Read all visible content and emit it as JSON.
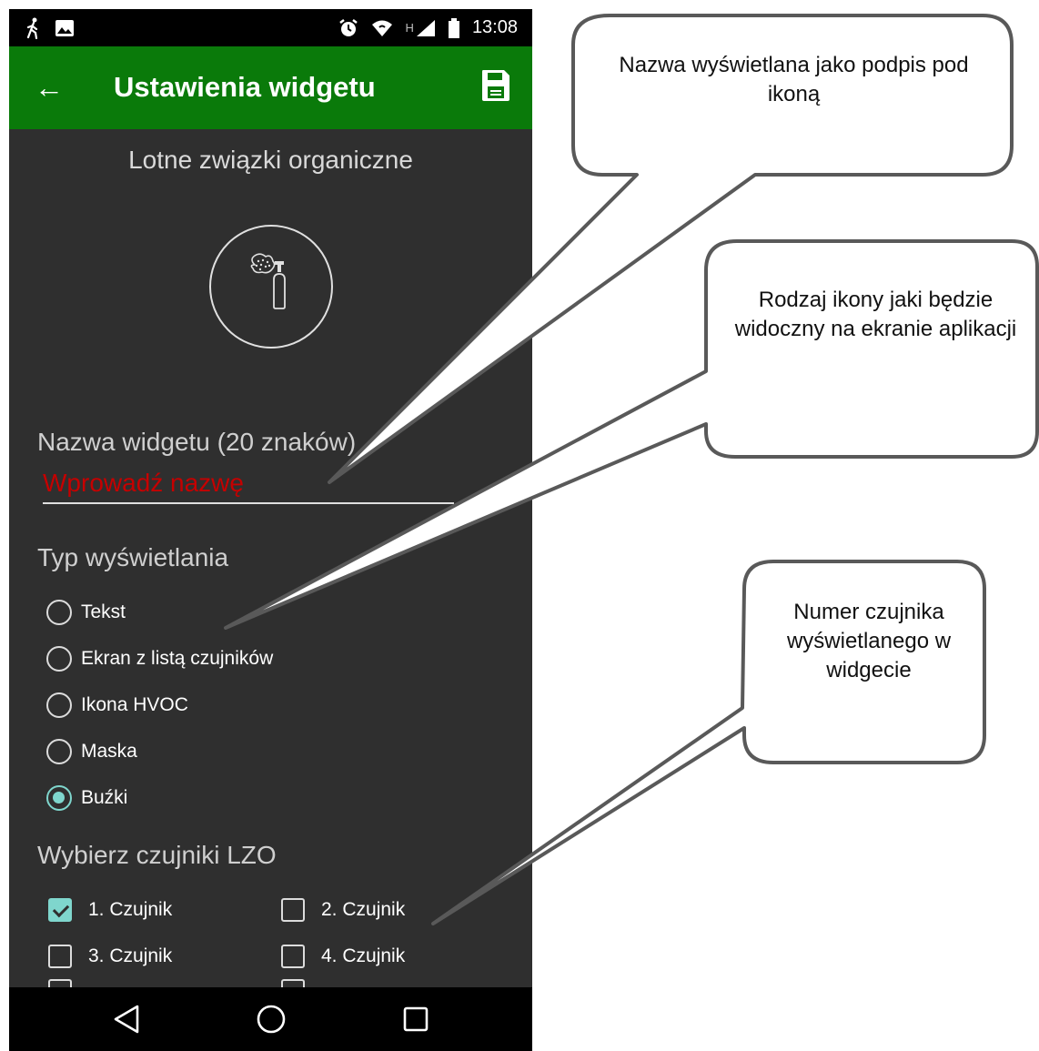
{
  "statusbar": {
    "time": "13:08",
    "network": "H"
  },
  "appbar": {
    "back_glyph": "←",
    "title": "Ustawienia widgetu",
    "save_icon": "save-icon"
  },
  "sensor_type": "Lotne związki organiczne",
  "widget_icon": "hvoc-spray-icon",
  "name_section": {
    "label": "Nazwa widgetu (20 znaków)",
    "placeholder": "Wprowadź nazwę"
  },
  "display_section": {
    "label": "Typ wyświetlania",
    "options": [
      {
        "label": "Tekst",
        "checked": false
      },
      {
        "label": "Ekran z listą czujników",
        "checked": false
      },
      {
        "label": "Ikona HVOC",
        "checked": false
      },
      {
        "label": "Maska",
        "checked": false
      },
      {
        "label": "Buźki",
        "checked": true
      }
    ]
  },
  "sensors_section": {
    "label": "Wybierz czujniki LZO",
    "sensors": [
      {
        "label": "1. Czujnik",
        "checked": true
      },
      {
        "label": "2. Czujnik",
        "checked": false
      },
      {
        "label": "3. Czujnik",
        "checked": false
      },
      {
        "label": "4. Czujnik",
        "checked": false
      }
    ]
  },
  "callouts": [
    {
      "text": "Nazwa wyświetlana jako podpis pod ikoną"
    },
    {
      "text": "Rodzaj ikony jaki będzie widoczny na ekranie aplikacji"
    },
    {
      "text": "Numer czujnika wyświetlanego w widgecie"
    }
  ],
  "colors": {
    "appbar": "#0a7a0a",
    "accent": "#7fd6cd",
    "placeholder": "#c50000",
    "background": "#2f2f2f"
  }
}
